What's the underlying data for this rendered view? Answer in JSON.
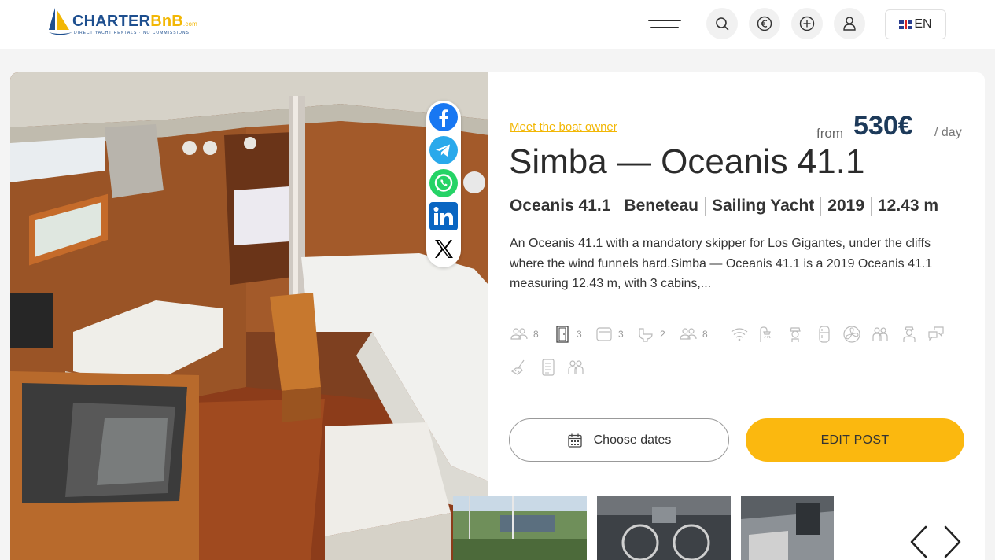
{
  "header": {
    "logo": {
      "name": "CHARTERBnB",
      "part1": "CHARTER",
      "part2": "BnB",
      "suffix": ".com",
      "tagline": "DIRECT YACHT RENTALS · NO COMMISSIONS"
    },
    "icons": [
      "menu-icon",
      "search-icon",
      "euro-icon",
      "plus-circle-icon",
      "user-icon",
      "uk-flag-icon"
    ],
    "language": "EN"
  },
  "share": {
    "icons": [
      "facebook-icon",
      "telegram-icon",
      "whatsapp-icon",
      "linkedin-icon",
      "x-icon"
    ],
    "colors": {
      "facebook": "#1877F2",
      "telegram": "#29A9EB",
      "whatsapp": "#25D366",
      "linkedin": "#0A66C2",
      "x": "#000000"
    }
  },
  "listing": {
    "owner_link": "Meet the boat owner",
    "price_from": "from",
    "price": "530€",
    "price_unit": "/ day",
    "title": "Simba — Oceanis 41.1",
    "specs": [
      "Oceanis 41.1",
      "Beneteau",
      "Sailing Yacht",
      "2019",
      "12.43 m"
    ],
    "description": "An Oceanis 41.1 with a mandatory skipper for Los Gigantes, under the cliffs where the wind funnels hard.Simba — Oceanis 41.1 is a 2019 Oceanis 41.1 measuring 12.43 m, with 3 cabins,...",
    "amenities": [
      {
        "icon": "guests-icon",
        "count": "8"
      },
      {
        "icon": "door-cabin-icon",
        "count": "3"
      },
      {
        "icon": "bed-icon",
        "count": "3"
      },
      {
        "icon": "toilet-icon",
        "count": "2"
      },
      {
        "icon": "people-icon",
        "count": "8"
      },
      {
        "icon": "wifi-icon"
      },
      {
        "icon": "shower-icon"
      },
      {
        "icon": "skipper-icon"
      },
      {
        "icon": "fridge-icon"
      },
      {
        "icon": "fan-icon"
      },
      {
        "icon": "crew-icon"
      },
      {
        "icon": "host-icon"
      },
      {
        "icon": "chat-icon"
      },
      {
        "icon": "cleaning-icon"
      },
      {
        "icon": "document-icon"
      },
      {
        "icon": "group-icon"
      }
    ],
    "choose_dates": "Choose dates",
    "edit_post": "EDIT POST",
    "accent_color": "#FBB80F",
    "price_color": "#1D3A5A"
  },
  "gallery": {
    "icons": [
      "prev-arrow-icon",
      "next-arrow-icon"
    ]
  }
}
